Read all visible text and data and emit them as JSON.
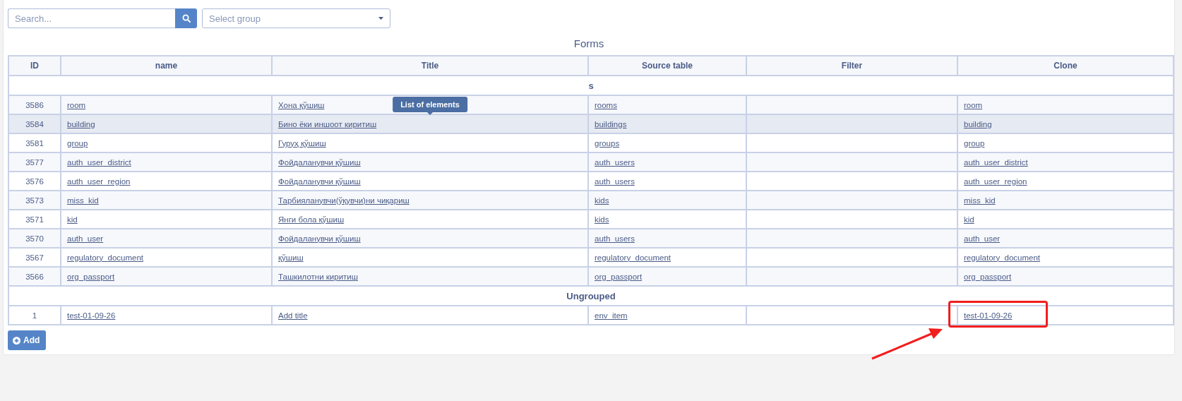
{
  "search": {
    "placeholder": "Search..."
  },
  "group_select": {
    "placeholder": "Select group"
  },
  "table": {
    "title": "Forms",
    "columns": [
      "ID",
      "name",
      "Title",
      "Source table",
      "Filter",
      "Clone"
    ],
    "groups": [
      {
        "label": "s",
        "rows": [
          {
            "id": "3586",
            "name": "room",
            "title": "Хона қўшиш",
            "source": "rooms",
            "clone": "room",
            "selected": false
          },
          {
            "id": "3584",
            "name": "building",
            "title": "Бино ёки иншоот киритиш",
            "source": "buildings",
            "clone": "building",
            "selected": true,
            "tooltip": "List of elements"
          },
          {
            "id": "3581",
            "name": "group",
            "title": "Гуруҳ қўшиш",
            "source": "groups",
            "clone": "group",
            "selected": false
          },
          {
            "id": "3577",
            "name": "auth_user_district",
            "title": "Фойдаланувчи қўшиш",
            "source": "auth_users",
            "clone": "auth_user_district",
            "selected": false
          },
          {
            "id": "3576",
            "name": "auth_user_region",
            "title": "Фойдаланувчи қўшиш",
            "source": "auth_users",
            "clone": "auth_user_region",
            "selected": false
          },
          {
            "id": "3573",
            "name": "miss_kid",
            "title": "Тарбияланувчи(ўқувчи)ни чиқариш",
            "source": "kids",
            "clone": "miss_kid",
            "selected": false
          },
          {
            "id": "3571",
            "name": "kid",
            "title": "Янги бола қўшиш",
            "source": "kids",
            "clone": "kid",
            "selected": false
          },
          {
            "id": "3570",
            "name": "auth_user",
            "title": "Фойдаланувчи қўшиш",
            "source": "auth_users",
            "clone": "auth_user",
            "selected": false
          },
          {
            "id": "3567",
            "name": "regulatory_document",
            "title": "қўшиш",
            "source": "regulatory_document",
            "clone": "regulatory_document",
            "selected": false
          },
          {
            "id": "3566",
            "name": "org_passport",
            "title": "Ташкилотни киритиш",
            "source": "org_passport",
            "clone": "org_passport",
            "selected": false
          }
        ]
      },
      {
        "label": "Ungrouped",
        "rows": [
          {
            "id": "1",
            "name": "test-01-09-26",
            "title": "Add title",
            "source": "env_item",
            "clone": "test-01-09-26",
            "selected": false,
            "marked": true
          }
        ]
      }
    ]
  },
  "add_button": {
    "label": "Add"
  }
}
